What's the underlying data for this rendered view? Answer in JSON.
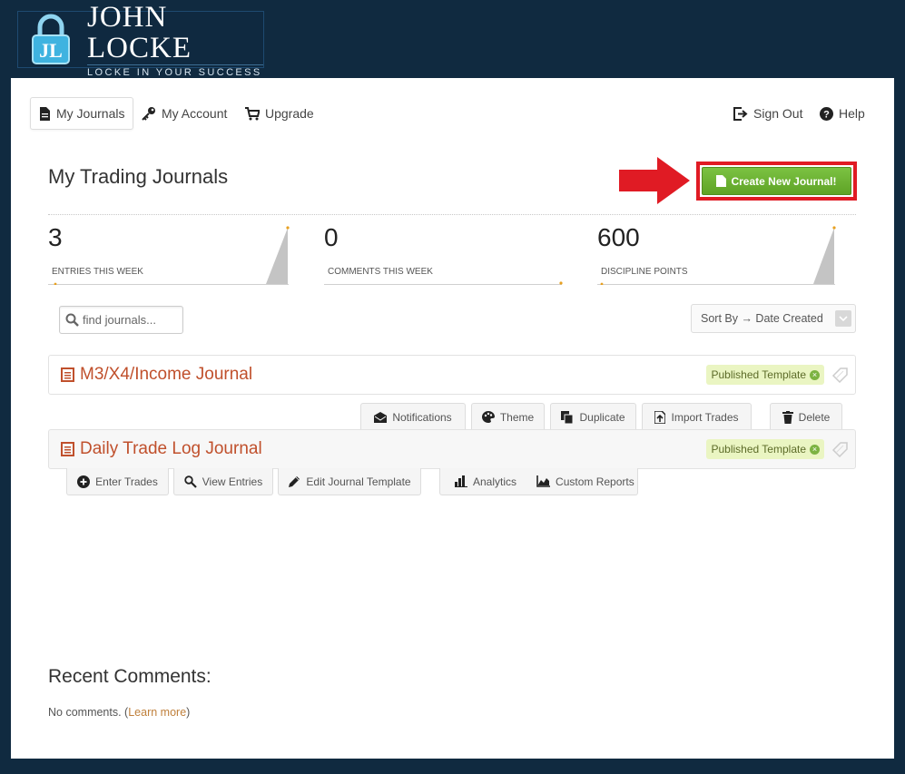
{
  "brand": {
    "logo_initials": "JL",
    "title_line1": "JOHN LOCKE",
    "tagline": "LOCKE IN YOUR SUCCESS"
  },
  "nav": {
    "my_journals": "My Journals",
    "my_account": "My Account",
    "upgrade": "Upgrade",
    "sign_out": "Sign Out",
    "help": "Help"
  },
  "page": {
    "title": "My Trading Journals",
    "create_button": "Create New Journal!"
  },
  "stats": [
    {
      "value": "3",
      "label": "ENTRIES THIS WEEK"
    },
    {
      "value": "0",
      "label": "COMMENTS THIS WEEK"
    },
    {
      "value": "600",
      "label": "DISCIPLINE POINTS"
    }
  ],
  "search": {
    "placeholder": "find journals..."
  },
  "sort": {
    "label": "Sort By → Date Created"
  },
  "journals": [
    {
      "title": "M3/X4/Income Journal",
      "badge": "Published Template"
    },
    {
      "title": "Daily Trade Log Journal",
      "badge": "Published Template"
    }
  ],
  "journal_actions_top": {
    "notifications": "Notifications",
    "theme": "Theme",
    "duplicate": "Duplicate",
    "import_trades": "Import Trades",
    "delete": "Delete"
  },
  "journal_actions_bottom": {
    "enter_trades": "Enter Trades",
    "view_entries": "View Entries",
    "edit_template": "Edit Journal Template",
    "analytics": "Analytics",
    "custom_reports": "Custom Reports"
  },
  "recent": {
    "title": "Recent Comments:",
    "text_before": "No comments. (",
    "link": "Learn more",
    "text_after": ")"
  },
  "colors": {
    "background": "#102a40",
    "accent_green": "#6ab230",
    "highlight_red": "#e01b24",
    "journal_title": "#c0502c",
    "badge_bg": "#eaf5c2"
  }
}
